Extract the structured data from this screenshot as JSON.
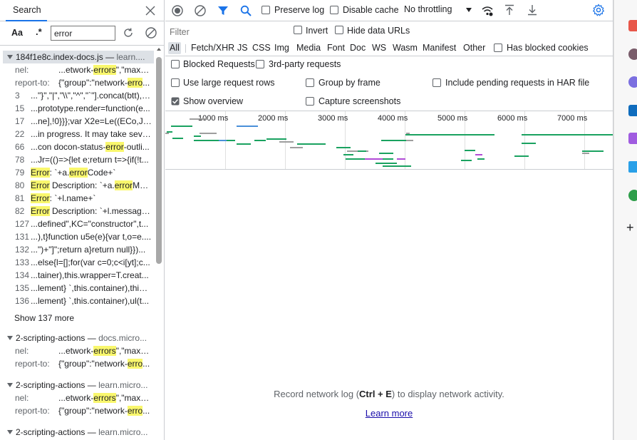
{
  "search": {
    "tab_label": "Search",
    "match_case_label": "Aa",
    "regex_label": ".*",
    "query": "error",
    "show_more_label": "Show 137 more",
    "results": [
      {
        "file": "184f1e8c.index-docs.js",
        "sep": "—",
        "origin": "learn....",
        "matches": [
          {
            "line": "nel:",
            "pre": "...etwork-",
            "hit": "errors",
            "post": "\",\"max_age\":6..."
          },
          {
            "line": "report-to:",
            "pre": "{\"group\":\"network-",
            "hit": "erro",
            "post": "..."
          },
          {
            "line": "3",
            "pre": "...\"}\",\"|\",\"\\\\\",\"^\",\"`\"].concat(btt),y...",
            "hit": "",
            "post": ""
          },
          {
            "line": "15",
            "pre": "...prototype.render=function(e...",
            "hit": "",
            "post": ""
          },
          {
            "line": "17",
            "pre": "...ne],!0}}};var X2e=Le((ECo,J2e)...",
            "hit": "",
            "post": ""
          },
          {
            "line": "22",
            "pre": "...in progress. It may take sever...",
            "hit": "",
            "post": ""
          },
          {
            "line": "66",
            "pre": "...con docon-status-",
            "hit": "error",
            "post": "-outli..."
          },
          {
            "line": "78",
            "pre": "...Jr=(()=>{let e;return t=>{if(!t...",
            "hit": "",
            "post": ""
          },
          {
            "line": "79",
            "pre": "",
            "hit": "Error",
            "post": ": `+a.",
            "hit2": "error",
            "post2": "Code+`"
          },
          {
            "line": "80",
            "pre": "",
            "hit": "Error",
            "post": " Description: `+a.",
            "hit2": "error",
            "post2": "Mes..."
          },
          {
            "line": "81",
            "pre": "",
            "hit": "Error",
            "post": ": `+l.name+`"
          },
          {
            "line": "82",
            "pre": "",
            "hit": "Error",
            "post": " Description: `+l.message)..."
          },
          {
            "line": "127",
            "pre": "...defined\",KC=\"constructor\",t...",
            "hit": "",
            "post": ""
          },
          {
            "line": "131",
            "pre": "...),t}function u5e(e){var t,o=e....",
            "hit": "",
            "post": ""
          },
          {
            "line": "132",
            "pre": "...\")+\"]\";return a}return null}})...",
            "hit": "",
            "post": ""
          },
          {
            "line": "133",
            "pre": "...else{l=[];for(var c=0;c<i[yt];c...",
            "hit": "",
            "post": ""
          },
          {
            "line": "134",
            "pre": "...tainer),this.wrapper=T.creat...",
            "hit": "",
            "post": ""
          },
          {
            "line": "135",
            "pre": "...lement} `,this.container),this....",
            "hit": "",
            "post": ""
          },
          {
            "line": "136",
            "pre": "...lement} `,this.container),ul(t...",
            "hit": "",
            "post": ""
          }
        ]
      },
      {
        "file": "2-scripting-actions",
        "sep": "—",
        "origin": "docs.micro...",
        "matches": [
          {
            "line": "nel:",
            "pre": "...etwork-",
            "hit": "errors",
            "post": "\",\"max_age\":6..."
          },
          {
            "line": "report-to:",
            "pre": "{\"group\":\"network-",
            "hit": "erro",
            "post": "..."
          }
        ]
      },
      {
        "file": "2-scripting-actions",
        "sep": "—",
        "origin": "learn.micro...",
        "matches": [
          {
            "line": "nel:",
            "pre": "...etwork-",
            "hit": "errors",
            "post": "\",\"max_age\":6..."
          },
          {
            "line": "report-to:",
            "pre": "{\"group\":\"network-",
            "hit": "erro",
            "post": "..."
          }
        ]
      },
      {
        "file": "2-scripting-actions",
        "sep": "—",
        "origin": "learn.micro...",
        "matches": []
      }
    ]
  },
  "network": {
    "preserve_log": "Preserve log",
    "disable_cache": "Disable cache",
    "throttling": "No throttling",
    "filter_placeholder": "Filter",
    "invert": "Invert",
    "hide_data_urls": "Hide data URLs",
    "types": [
      "All",
      "Fetch/XHR",
      "JS",
      "CSS",
      "Img",
      "Media",
      "Font",
      "Doc",
      "WS",
      "Wasm",
      "Manifest",
      "Other"
    ],
    "has_blocked_cookies": "Has blocked cookies",
    "blocked_requests": "Blocked Requests",
    "third_party": "3rd-party requests",
    "large_rows": "Use large request rows",
    "group_by_frame": "Group by frame",
    "include_pending": "Include pending requests in HAR file",
    "show_overview": "Show overview",
    "capture_screenshots": "Capture screenshots",
    "timeline_labels": [
      "1000 ms",
      "2000 ms",
      "3000 ms",
      "4000 ms",
      "5000 ms",
      "6000 ms",
      "7000 ms"
    ],
    "empty_pre": "Record network log (",
    "empty_key": "Ctrl + E",
    "empty_post": ") to display network activity.",
    "learn_more": "Learn more"
  },
  "colors": {
    "accent": "#1a73e8",
    "highlight": "#f9f76d",
    "bar_green": "#1aa260",
    "bar_blue": "#4a90d9",
    "bar_purple": "#b04bd6",
    "bar_gray": "#9e9e9e"
  }
}
